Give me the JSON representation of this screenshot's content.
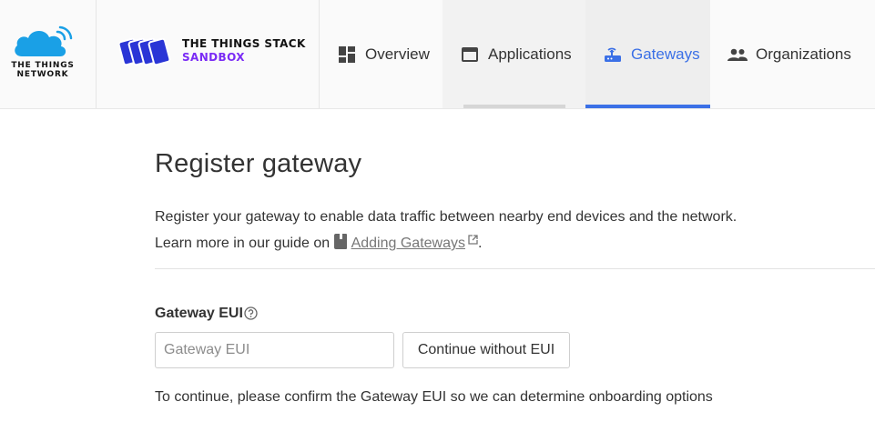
{
  "brand": {
    "ttn_line1": "THE THINGS",
    "ttn_line2": "NETWORK",
    "tts_line1": "THE THINGS STACK",
    "tts_line2": "SANDBOX",
    "tts_accent_color": "#7a2bf5",
    "ttn_cloud_color": "#1aa0e6"
  },
  "nav": {
    "items": [
      {
        "label": "Overview",
        "icon": "dashboard-icon",
        "active": false
      },
      {
        "label": "Applications",
        "icon": "web-asset-icon",
        "active": false
      },
      {
        "label": "Gateways",
        "icon": "router-icon",
        "active": true
      },
      {
        "label": "Organizations",
        "icon": "people-icon",
        "active": false
      }
    ],
    "active_color": "#3b70e6"
  },
  "main": {
    "title": "Register gateway",
    "description_line1": "Register your gateway to enable data traffic between nearby end devices and the network.",
    "description_line2_prefix": "Learn more in our guide on",
    "guide_link": "Adding Gateways",
    "description_line2_suffix": ".",
    "field_label": "Gateway EUI",
    "eui_placeholder": "Gateway EUI",
    "eui_value": "",
    "continue_button": "Continue without EUI",
    "hint": "To continue, please confirm the Gateway EUI so we can determine onboarding options"
  }
}
